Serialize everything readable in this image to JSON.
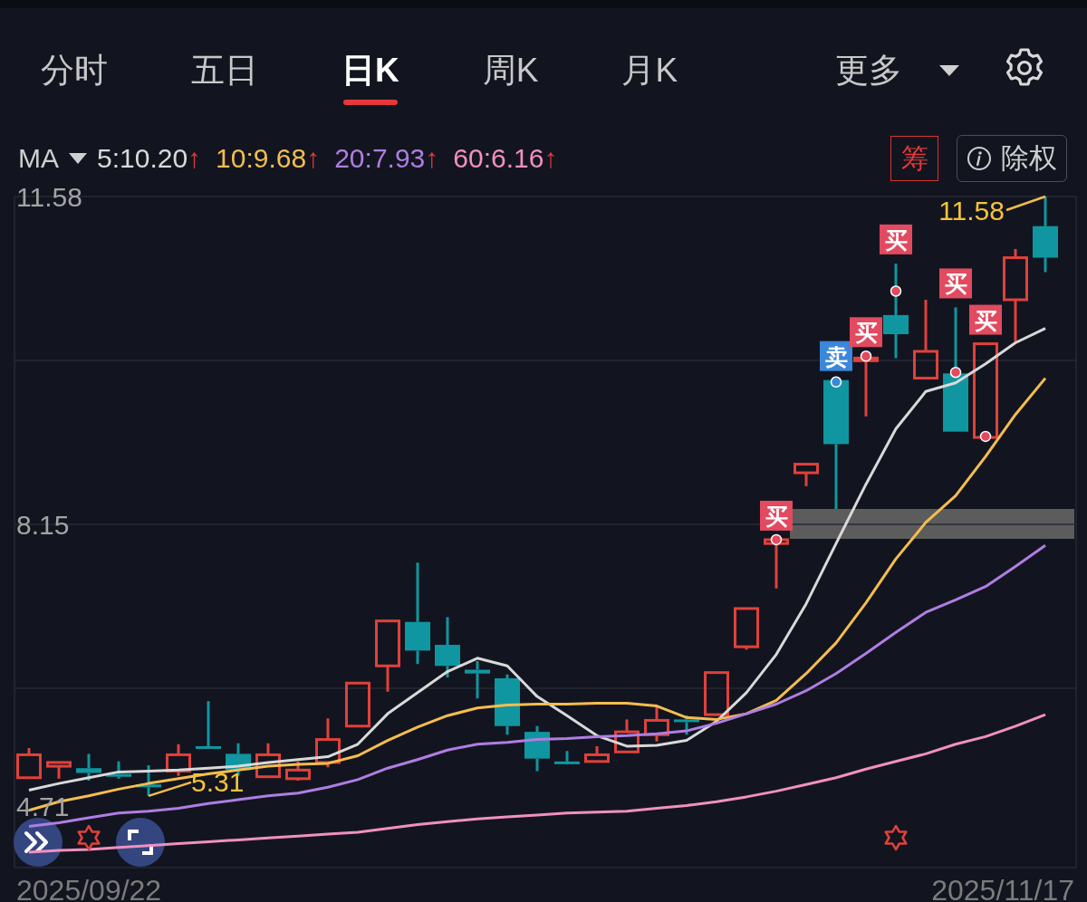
{
  "tabs": [
    {
      "label": "分时",
      "selected": false
    },
    {
      "label": "五日",
      "selected": false
    },
    {
      "label": "日K",
      "selected": true
    },
    {
      "label": "周K",
      "selected": false
    },
    {
      "label": "月K",
      "selected": false
    },
    {
      "label": "更多",
      "selected": false,
      "dropdown": true
    }
  ],
  "ma_legend": {
    "label": "MA",
    "items": [
      {
        "text": "5:10.20",
        "arrow": "↑"
      },
      {
        "text": "10:9.68",
        "arrow": "↑"
      },
      {
        "text": "20:7.93",
        "arrow": "↑"
      },
      {
        "text": "60:6.16",
        "arrow": "↑"
      }
    ]
  },
  "chip_button": "筹",
  "adjust_button": "除权",
  "chart": {
    "bottom_label": "4.71",
    "high_label": "11.58",
    "low_label": "5.31",
    "date_labels": [
      "2025/09/22",
      "2025/11/17"
    ],
    "signals": [
      {
        "text": "买",
        "kind": "buy"
      },
      {
        "text": "卖",
        "kind": "sell"
      },
      {
        "text": "买",
        "kind": "buy"
      },
      {
        "text": "买",
        "kind": "buy"
      },
      {
        "text": "买",
        "kind": "buy"
      },
      {
        "text": "买",
        "kind": "buy"
      }
    ],
    "chart_data": {
      "type": "line",
      "ylim": [
        4.56,
        11.58
      ],
      "yticks": [
        8.15,
        11.58
      ],
      "series": [
        {
          "color": "#d9d9d9",
          "values": [
            5.37,
            5.44,
            5.5,
            5.56,
            5.57,
            5.58,
            5.6,
            5.62,
            5.66,
            5.69,
            5.72,
            5.85,
            6.17,
            6.39,
            6.61,
            6.75,
            6.67,
            6.35,
            6.15,
            5.94,
            5.83,
            5.84,
            5.89,
            6.09,
            6.39,
            6.79,
            7.32,
            7.95,
            8.57,
            9.15,
            9.54,
            9.63,
            9.83,
            10.05,
            10.2
          ]
        },
        {
          "color": "#f5bd4f",
          "values": [
            5.16,
            5.25,
            5.31,
            5.38,
            5.44,
            5.49,
            5.54,
            5.58,
            5.62,
            5.64,
            5.65,
            5.73,
            5.89,
            6.03,
            6.15,
            6.23,
            6.26,
            6.27,
            6.27,
            6.28,
            6.28,
            6.25,
            6.13,
            6.11,
            6.17,
            6.31,
            6.59,
            6.91,
            7.33,
            7.79,
            8.17,
            8.45,
            8.86,
            9.3,
            9.68
          ]
        },
        {
          "color": "#b07de3",
          "values": [
            4.99,
            5.03,
            5.08,
            5.13,
            5.15,
            5.18,
            5.23,
            5.27,
            5.31,
            5.34,
            5.4,
            5.48,
            5.6,
            5.69,
            5.79,
            5.85,
            5.87,
            5.9,
            5.91,
            5.93,
            5.94,
            5.96,
            5.99,
            6.07,
            6.17,
            6.27,
            6.41,
            6.59,
            6.8,
            7.02,
            7.23,
            7.36,
            7.5,
            7.71,
            7.93
          ]
        },
        {
          "color": "#f28fc2",
          "values": [
            4.72,
            4.74,
            4.75,
            4.77,
            4.79,
            4.81,
            4.83,
            4.85,
            4.87,
            4.89,
            4.91,
            4.93,
            4.97,
            5.01,
            5.04,
            5.07,
            5.09,
            5.11,
            5.13,
            5.14,
            5.15,
            5.18,
            5.21,
            5.25,
            5.3,
            5.36,
            5.43,
            5.5,
            5.59,
            5.67,
            5.75,
            5.85,
            5.93,
            6.04,
            6.16
          ]
        }
      ]
    }
  }
}
